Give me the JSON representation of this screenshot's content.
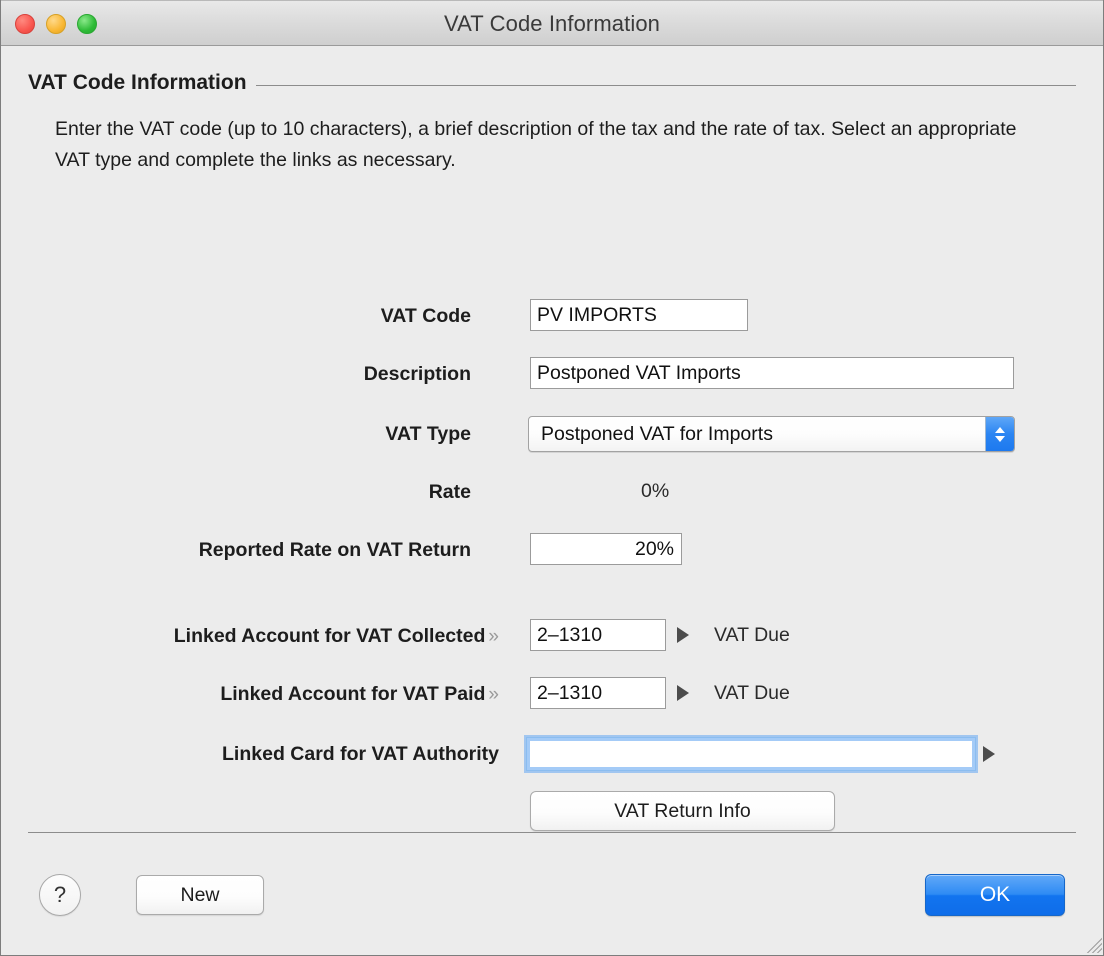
{
  "window": {
    "title": "VAT Code Information",
    "traffic_lights": [
      {
        "name": "close",
        "color": "#f9564f"
      },
      {
        "name": "minimize",
        "color": "#f9b733"
      },
      {
        "name": "zoom",
        "color": "#2ebb37"
      }
    ]
  },
  "group": {
    "title": "VAT Code Information",
    "intro": "Enter the VAT code (up to 10 characters), a brief description of the tax and the rate of tax.  Select an appropriate VAT type and complete the links as necessary."
  },
  "form": {
    "vat_code": {
      "label": "VAT Code",
      "value": "PV IMPORTS",
      "placeholder": ""
    },
    "description": {
      "label": "Description",
      "value": "Postponed VAT Imports",
      "placeholder": ""
    },
    "vat_type": {
      "label": "VAT Type",
      "value": "Postponed VAT for Imports",
      "options": [
        "Postponed VAT for Imports"
      ]
    },
    "rate": {
      "label": "Rate",
      "value": "0%"
    },
    "reported_rate": {
      "label": "Reported Rate on VAT Return",
      "value": "20%",
      "placeholder": ""
    },
    "linked_account_collected": {
      "label": "Linked Account for VAT Collected",
      "chevron": "»",
      "value": "2–1310",
      "account_name": "VAT Due",
      "placeholder": ""
    },
    "linked_account_paid": {
      "label": "Linked Account for VAT Paid",
      "chevron": "»",
      "value": "2–1310",
      "account_name": "VAT Due",
      "placeholder": ""
    },
    "linked_card_authority": {
      "label": "Linked Card for VAT Authority",
      "value": "",
      "account_name": "",
      "placeholder": "",
      "focused": true
    },
    "vat_return_info_button": "VAT Return Info"
  },
  "footer": {
    "help_label": "?",
    "new_label": "New",
    "ok_label": "OK"
  },
  "colors": {
    "window_background": "#ececec",
    "titlebar_top": "#e9e9e9",
    "titlebar_bottom": "#cfcfcf",
    "accent_blue": "#1274ef",
    "focus_ring": "#64a8f4",
    "field_border": "#9b9b9b",
    "rule": "#8c8c8c",
    "text": "#1d1d1d"
  }
}
